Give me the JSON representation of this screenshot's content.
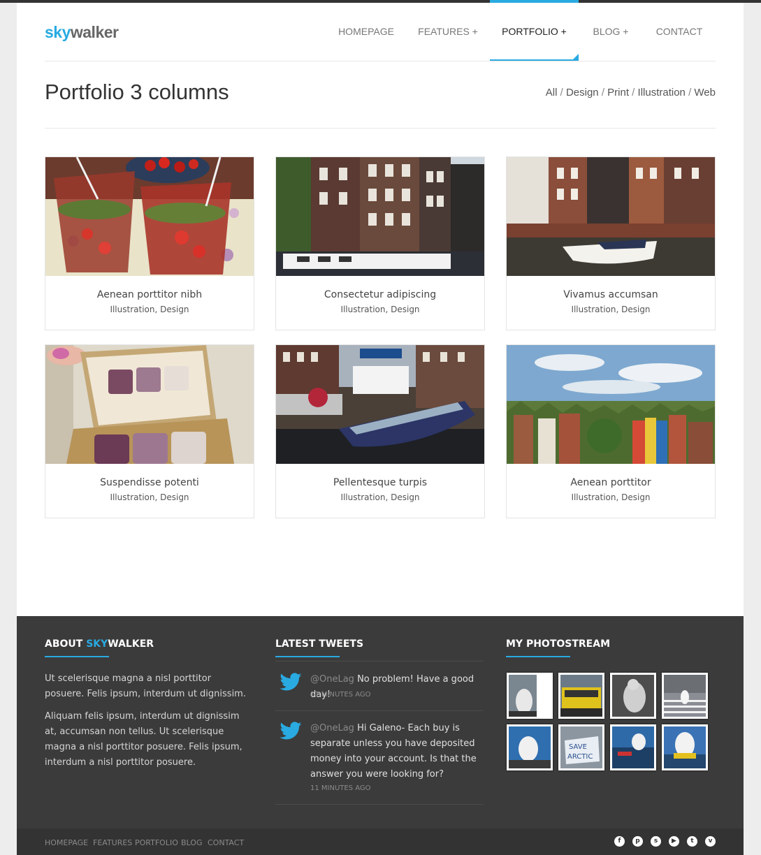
{
  "brand": {
    "part1": "sky",
    "part2": "walker",
    "accent": "#29aae1"
  },
  "toggle_symbol": "+",
  "nav": [
    {
      "label": "HOMEPAGE",
      "active": false
    },
    {
      "label": "FEATURES +",
      "active": false
    },
    {
      "label": "PORTFOLIO +",
      "active": true
    },
    {
      "label": "BLOG +",
      "active": false
    },
    {
      "label": "CONTACT",
      "active": false
    }
  ],
  "page_title": "Portfolio 3 columns",
  "filters": [
    "All",
    "Design",
    "Print",
    "Illustration",
    "Web"
  ],
  "portfolio": [
    {
      "title": "Aenean porttitor nibh",
      "tags": "Illustration, Design",
      "image": "drinks"
    },
    {
      "title": "Consectetur adipiscing",
      "tags": "Illustration, Design",
      "image": "canal-houses"
    },
    {
      "title": "Vivamus accumsan",
      "tags": "Illustration, Design",
      "image": "canal-boat"
    },
    {
      "title": "Suspendisse potenti",
      "tags": "Illustration, Design",
      "image": "eyeshadow-palette"
    },
    {
      "title": "Pellentesque turpis",
      "tags": "Illustration, Design",
      "image": "tour-boat"
    },
    {
      "title": "Aenean porttitor",
      "tags": "Illustration, Design",
      "image": "city-skyline"
    }
  ],
  "footer": {
    "about": {
      "heading_prefix": "ABOUT ",
      "heading_highlight": "SKY",
      "heading_suffix": "WALKER",
      "p1": "Ut scelerisque magna a nisl porttitor posuere. Felis ipsum, interdum ut dignissim.",
      "p2": "Aliquam felis ipsum, interdum ut dignissim at, accumsan non tellus. Ut scelerisque magna a nisl porttitor posuere. Felis ipsum, interdum a nisl porttitor posuere."
    },
    "tweets": {
      "heading": "LATEST TWEETS",
      "items": [
        {
          "user": "@OneLag",
          "text": "No problem! Have a good day!",
          "time": "11 MINUTES AGO"
        },
        {
          "user": "@OneLag",
          "text": "Hi Galeno- Each buy is separate unless you have deposited money into your account. Is that the answer you were looking for?",
          "time": "11 MINUTES AGO"
        }
      ]
    },
    "photostream": {
      "heading": "MY PHOTOSTREAM",
      "thumbs": [
        "polar-bear-statue",
        "yellow-bus",
        "bear-sculpture",
        "crosswalk",
        "polar-bear-sky",
        "save-arctic-sign",
        "harbor",
        "bear-boat"
      ]
    }
  },
  "footer_nav": [
    "HOMEPAGE",
    "FEATURES",
    "PORTFOLIO",
    "BLOG",
    "CONTACT"
  ],
  "social_icons": [
    "facebook-icon",
    "pinterest-icon",
    "skype-icon",
    "youtube-icon",
    "twitter-icon",
    "vimeo-icon"
  ]
}
